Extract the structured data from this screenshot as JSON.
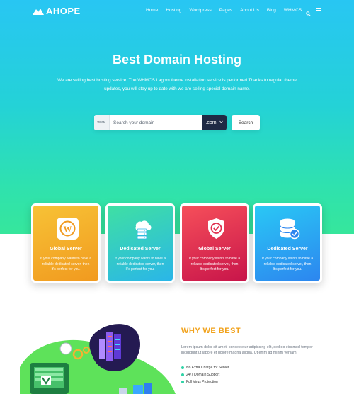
{
  "brand": {
    "name": "AHOPE"
  },
  "nav": {
    "items": [
      "Home",
      "Hosting",
      "Wordpress",
      "Pages",
      "About Us",
      "Blog",
      "WHMCS"
    ]
  },
  "hero": {
    "title": "Best Domain Hosting",
    "subtitle": "We are selling best hosting service. The WHMCS Lagom theme installation service is performed Thanks to regular theme updates, you will stay up to date with we are selling special domain name."
  },
  "search": {
    "prefix": "www.",
    "placeholder": "Search your domain",
    "tld": ".com",
    "button": "Search"
  },
  "cards": [
    {
      "title": "Global Server",
      "desc": "If your company wants to have a reliable dedicated server, then It's perfect for you.",
      "icon": "wordpress-icon"
    },
    {
      "title": "Dedicated Server",
      "desc": "If your company wants to have a reliable dedicated server, then It's perfect for you.",
      "icon": "cloud-server-icon"
    },
    {
      "title": "Global Server",
      "desc": "If your company wants to have a reliable dedicated server, then It's perfect for you.",
      "icon": "shield-check-icon"
    },
    {
      "title": "Dedicated Server",
      "desc": "If your company wants to have a reliable dedicated server, then It's perfect for you.",
      "icon": "database-check-icon"
    }
  ],
  "why": {
    "title": "WHY WE BEST",
    "text": "Lorem ipsum dolor sit amet, consectetur adipiscing elit, sed do eiusmod tempor incididunt ut labore et dolore magna aliqua. Ut enim ad minim veniam.",
    "items": [
      "No Extra Charge for Server",
      "24/7 Domain Support",
      "Full Virus Protection"
    ]
  },
  "colors": {
    "hero_top": "#28c6f3",
    "hero_bottom": "#36e69c",
    "accent": "#f1a21c",
    "dark": "#1f2a44"
  }
}
